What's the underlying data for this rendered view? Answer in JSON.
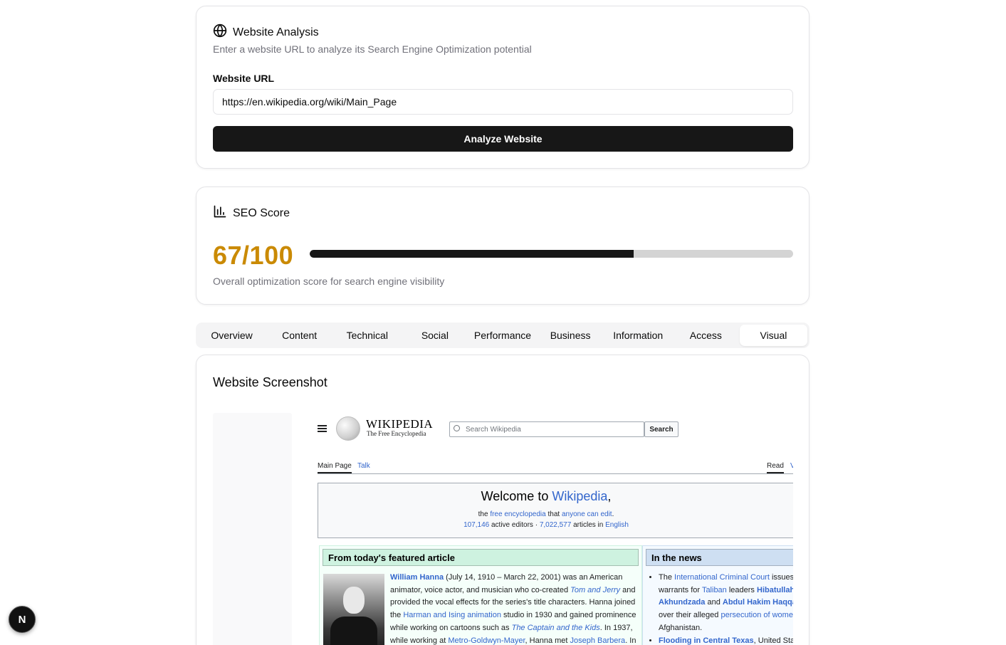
{
  "analysis": {
    "title": "Website Analysis",
    "description": "Enter a website URL to analyze its Search Engine Optimization potential",
    "url_label": "Website URL",
    "url_value": "https://en.wikipedia.org/wiki/Main_Page",
    "analyze_button": "Analyze Website",
    "icon": "globe-icon"
  },
  "score": {
    "title": "SEO Score",
    "value_text": "67/100",
    "value": 67,
    "max": 100,
    "progress_fraction": 0.67,
    "description": "Overall optimization score for search engine visibility",
    "icon": "bar-chart-icon",
    "color": "#ca8a04"
  },
  "tabs": [
    "Overview",
    "Content",
    "Technical",
    "Social",
    "Performance",
    "Business",
    "Information",
    "Access",
    "Visual"
  ],
  "active_tab": "Visual",
  "visual": {
    "title": "Website Screenshot"
  },
  "wiki": {
    "wordmark": "WIKIPEDIA",
    "tagline": "The Free Encyclopedia",
    "search_placeholder": "Search Wikipedia",
    "search_button": "Search",
    "tab_main": "Main Page",
    "tab_talk": "Talk",
    "tab_read": "Read",
    "tab_view_partial": "V",
    "welcome_prefix": "Welcome to ",
    "welcome_link": "Wikipedia",
    "welcome_suffix": ",",
    "line1_a": "the ",
    "line1_b": "free encyclopedia",
    "line1_c": " that ",
    "line1_d": "anyone can edit",
    "line1_e": ".",
    "line2_a": "107,146",
    "line2_b": " active editors · ",
    "line2_c": "7,022,577",
    "line2_d": " articles in ",
    "line2_e": "English",
    "featured_head": "From today's featured article",
    "feat_name": "William Hanna",
    "feat_t1": " (July 14, 1910 – March 22, 2001) was an American animator, voice actor, and musician who co-created ",
    "feat_tj": "Tom and Jerry",
    "feat_t2": " and provided the vocal effects for the series's title characters. Hanna joined the ",
    "feat_hi": "Harman and Ising animation",
    "feat_t3": " studio in 1930 and gained prominence while working on cartoons such as ",
    "feat_cap": "The Captain and the Kids",
    "feat_t4": ". In 1937, while working at ",
    "feat_mgm": "Metro-Goldwyn-Mayer",
    "feat_t5": ", Hanna met ",
    "feat_jb": "Joseph Barbera",
    "feat_t6": ". In",
    "news_head": "In the news",
    "news1_a": "The ",
    "news1_b": "International Criminal Court",
    "news1_c": " issues warrants for ",
    "news1_d": "Taliban",
    "news1_e": " leaders ",
    "news1_f": "Hibatullah Akhundzada",
    "news1_g": " and ",
    "news1_h": "Abdul Hakim Haqqa",
    "news1_i": " over their alleged ",
    "news1_j": "persecution of women",
    "news1_k": " Afghanistan.",
    "news2_a": "Flooding in Central Texas",
    "news2_b": ", United Stat"
  },
  "badge": {
    "label": "N"
  }
}
